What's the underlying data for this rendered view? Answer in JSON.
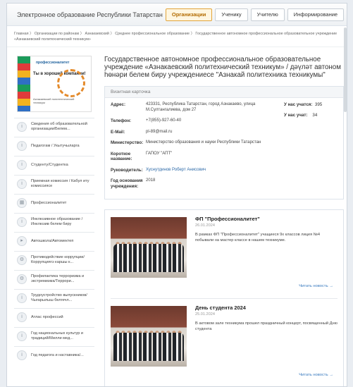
{
  "header": {
    "portal_title": "Электронное образование Республики Татарстан",
    "tabs": [
      {
        "label": "Организации",
        "active": true
      },
      {
        "label": "Ученику",
        "active": false
      },
      {
        "label": "Учителю",
        "active": false
      },
      {
        "label": "Информирование",
        "active": false
      }
    ]
  },
  "breadcrumb": "Главная 〉 Организации по районам 〉 Азнакаевский 〉 Среднее профессиональное образование 〉 Государственное автономное профессиональное образовательное учреждение «Азнакаевский политехнический техникум»",
  "logo": {
    "heading": "профессионалитет",
    "text": "Ты в хорошей компании!",
    "caption": "Азнакаевский политехнический техникум"
  },
  "menu": [
    {
      "label": "Сведения об образовательной организации/Белем...",
      "icon": "info-icon"
    },
    {
      "label": "Педагогам / Укытучыларга",
      "icon": "info-icon"
    },
    {
      "label": "Студенту/Студентка",
      "icon": "info-icon"
    },
    {
      "label": "Приемная комиссия / Кабул иту комиссиясе",
      "icon": "info-icon"
    },
    {
      "label": "Профессионалитет",
      "icon": "building-icon"
    },
    {
      "label": "Инклюзивное образование / Инклюзив белем биру",
      "icon": "info-icon"
    },
    {
      "label": "Автошкола/Автомектеп",
      "icon": "play-icon"
    },
    {
      "label": "Противодействие коррупции/Коррупциягэ каршы к...",
      "icon": "gear-icon"
    },
    {
      "label": "Профилактика терроризма и экстремизма/Террори...",
      "icon": "gear-icon"
    },
    {
      "label": "Трудоустройство выпускников/Чыгарылыш белгечл...",
      "icon": "info-icon"
    },
    {
      "label": "Атлас профессий",
      "icon": "info-icon"
    },
    {
      "label": "Год национальных культур и традиций/Милли мед...",
      "icon": "info-icon"
    },
    {
      "label": "Год педагога и наставника/...",
      "icon": "info-icon"
    }
  ],
  "org_title": "Государственное автономное профессиональное образовательное учреждение «Азнакаевский политехнический техникум» / дәүләт автоном һөнәри белем биру учреждениесе \"Азнакай политехника техникумы\"",
  "card": {
    "header": "Визитная карточка",
    "fields": [
      {
        "label": "Адрес:",
        "value": "423331, Республика Татарстан, город Азнакаево, улица М.Султангалиева, дом 27",
        "link": false
      },
      {
        "label": "Телефон:",
        "value": "+7(855)-927-60-40",
        "link": false
      },
      {
        "label": "E-Mail:",
        "value": "pl-89@mail.ru",
        "link": false
      },
      {
        "label": "Министерство:",
        "value": "Министерство образования и науки Республики Татарстан",
        "link": false
      },
      {
        "label": "Короткое название:",
        "value": "ГАПОУ \"АПТ\"",
        "link": false
      },
      {
        "label": "Руководитель:",
        "value": "Хуснутдинов Роберт Анисович",
        "link": true
      },
      {
        "label": "Год основания учреждения:",
        "value": "2018",
        "link": false
      }
    ],
    "stats": [
      {
        "label": "У нас учатся:",
        "value": "395"
      },
      {
        "label": "У нас учат:",
        "value": "34"
      }
    ]
  },
  "news": [
    {
      "title": "ФП \"Профессионалитет\"",
      "date": "26.01.2024",
      "desc": "В рамках ФП \"Профессионалитет\" учащиеся 9х классов лицея №4 побывали на мастер классе в нашем техникуме.",
      "more": "Читать новость →"
    },
    {
      "title": "День студента 2024",
      "date": "25.01.2024",
      "desc": "В актовом зале техникума прошел праздничный концерт, посвященный Дню студента",
      "more": "Читать новость →"
    }
  ]
}
